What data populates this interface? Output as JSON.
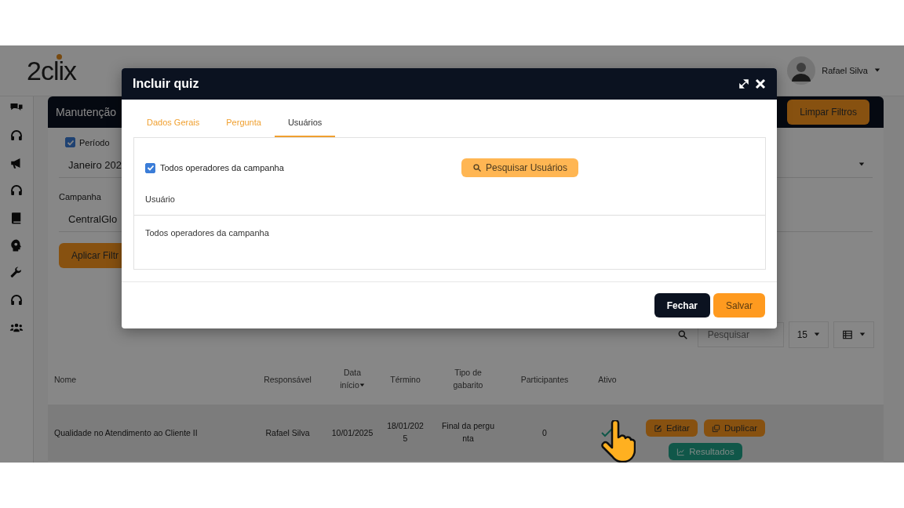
{
  "app": {
    "logo": "2clix",
    "user": {
      "name": "Rafael Silva"
    }
  },
  "page": {
    "title": "Manutenção",
    "clear_button": "Limpar Filtros",
    "filters": {
      "period": {
        "label": "Período",
        "checked": true
      },
      "period_value": "Janeiro 202",
      "campaign_label": "Campanha",
      "campaign_value": "CentralGlo",
      "apply_button": "Aplicar Filtr"
    },
    "table_tools": {
      "search_placeholder": "Pesquisar",
      "page_size": "15"
    },
    "table": {
      "columns": [
        "Nome",
        "Responsável",
        "Data início",
        "Término",
        "Tipo de gabarito",
        "Participantes",
        "Ativo"
      ],
      "rows": [
        {
          "cells": [
            "Qualidade no Atendimento ao Cliente II",
            "Rafael Silva",
            "10/01/2025",
            "18/01/2025",
            "Final da pergunta",
            "0"
          ],
          "active": true,
          "actions": [
            {
              "label": "Editar",
              "kind": "edit"
            },
            {
              "label": "Duplicar",
              "kind": "copy"
            },
            {
              "label": "Resultados",
              "kind": "results"
            }
          ]
        }
      ]
    }
  },
  "modal": {
    "title": "Incluir quiz",
    "tabs": [
      {
        "label": "Dados Gerais",
        "selected": false
      },
      {
        "label": "Pergunta",
        "selected": false
      },
      {
        "label": "Usuários",
        "selected": true
      }
    ],
    "all_operators": {
      "label": "Todos operadores da campanha",
      "checked": true
    },
    "search_button": "Pesquisar Usuários",
    "list": {
      "column": "Usuário",
      "rows": [
        "Todos operadores da campanha"
      ]
    },
    "buttons": [
      {
        "label": "Fechar",
        "kind": "dark"
      },
      {
        "label": "Salvar",
        "kind": "primary"
      }
    ]
  }
}
